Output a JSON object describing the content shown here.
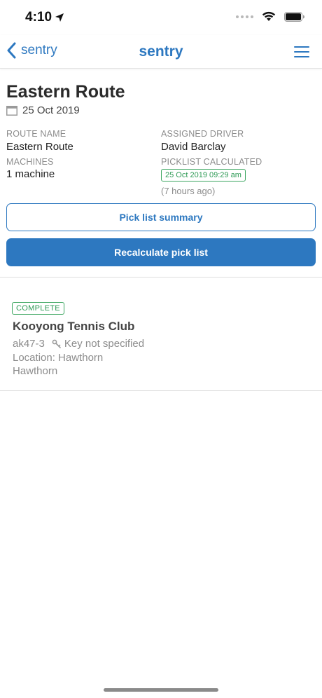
{
  "status_bar": {
    "time": "4:10",
    "icons": [
      "location-arrow-icon",
      "cellular-dots-icon",
      "wifi-icon",
      "battery-icon"
    ]
  },
  "nav": {
    "back_label": "sentry",
    "title": "sentry",
    "icons": [
      "chevron-left-icon",
      "hamburger-menu-icon"
    ]
  },
  "route": {
    "title": "Eastern Route",
    "date": "25 Oct 2019",
    "fields": {
      "route_name_label": "ROUTE NAME",
      "route_name_value": "Eastern Route",
      "assigned_driver_label": "ASSIGNED DRIVER",
      "assigned_driver_value": "David Barclay",
      "machines_label": "MACHINES",
      "machines_value": "1 machine",
      "picklist_label": "PICKLIST CALCULATED",
      "picklist_value": "25 Oct 2019 09:29 am",
      "picklist_ago": "(7 hours ago)"
    }
  },
  "actions": {
    "pick_list_summary": "Pick list summary",
    "recalculate": "Recalculate pick list"
  },
  "machines": [
    {
      "status": "COMPLETE",
      "name": "Kooyong Tennis Club",
      "machine_id": "ak47-3",
      "key": "Key not specified",
      "location": "Location: Hawthorn",
      "suburb": "Hawthorn"
    }
  ],
  "colors": {
    "accent": "#2d78c0",
    "success": "#2e9a55",
    "muted_text": "#8c8c8c"
  }
}
